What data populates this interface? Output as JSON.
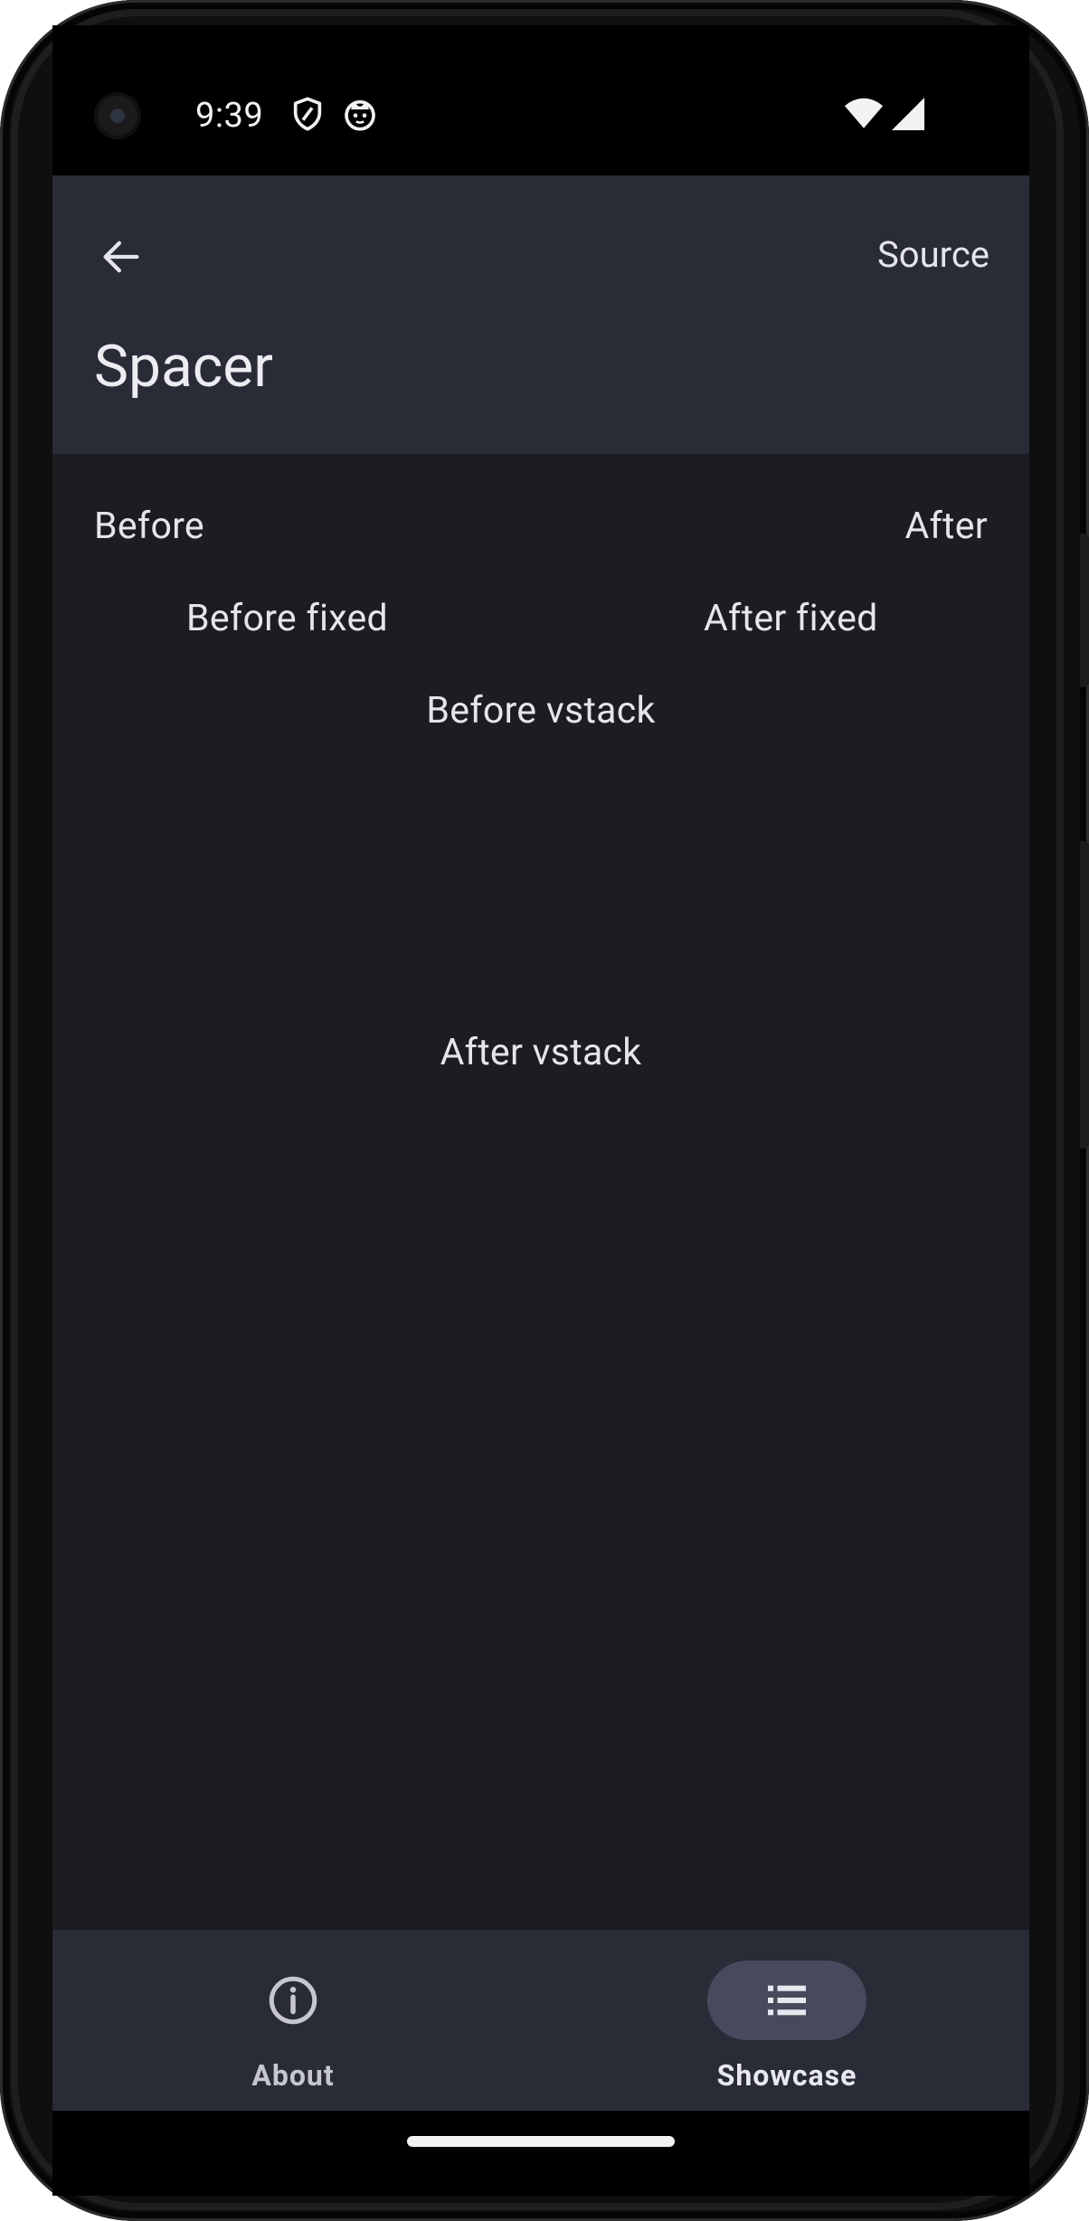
{
  "status_bar": {
    "time": "9:39",
    "icons": [
      "camera-icon",
      "shield-icon",
      "cat-icon",
      "wifi-icon",
      "signal-icon"
    ]
  },
  "top_bar": {
    "back_icon": "arrow-back-icon",
    "action_label": "Source",
    "title": "Spacer"
  },
  "content": {
    "row1": {
      "before": "Before",
      "after": "After"
    },
    "row2": {
      "before": "Before fixed",
      "after": "After fixed"
    },
    "vstack": {
      "before": "Before vstack",
      "after": "After vstack"
    }
  },
  "bottom_nav": {
    "items": [
      {
        "label": "About",
        "icon": "info-icon",
        "selected": false
      },
      {
        "label": "Showcase",
        "icon": "list-icon",
        "selected": true
      }
    ]
  },
  "colors": {
    "top_bar_bg": "#292b36",
    "content_bg": "#1c1d21",
    "selected_pill": "#464a5c",
    "text": "#e6e6ea"
  }
}
